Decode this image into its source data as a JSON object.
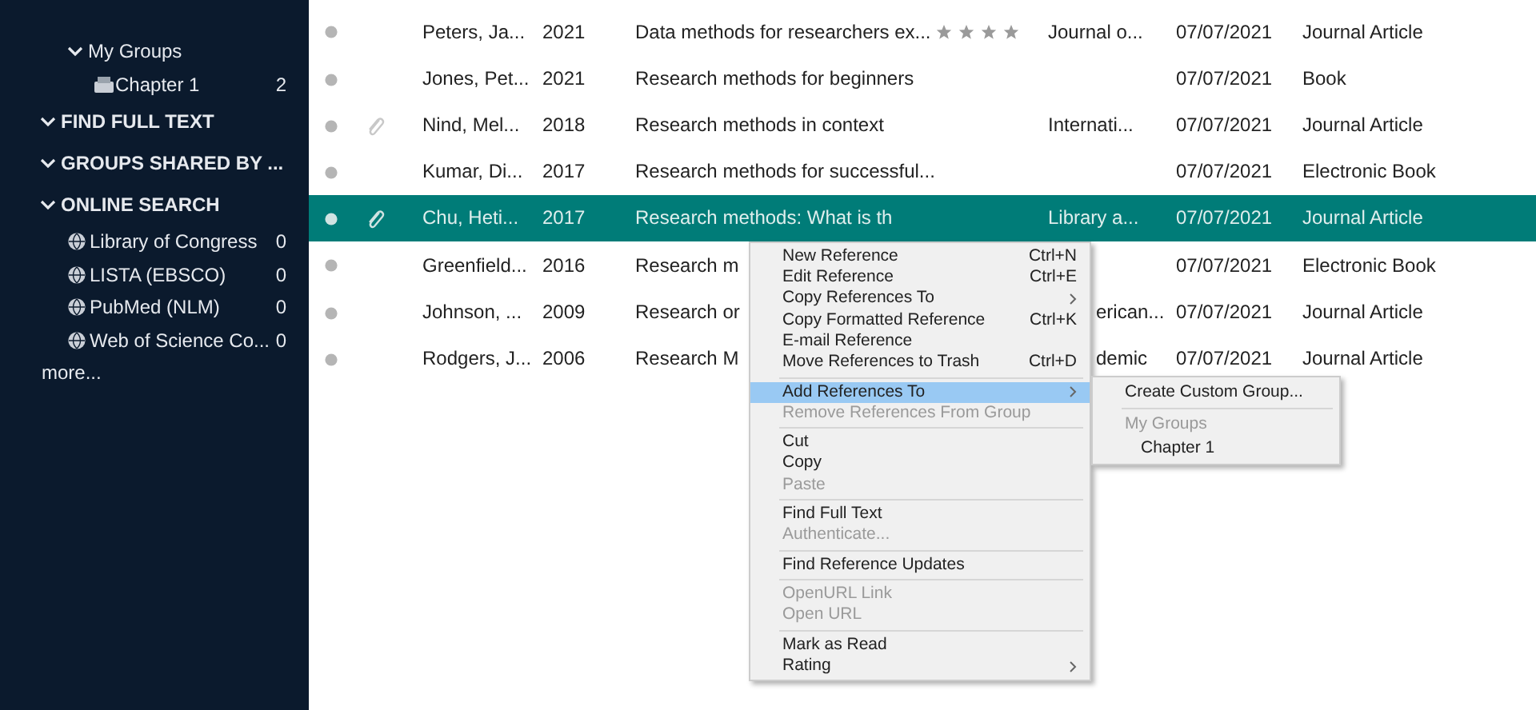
{
  "sidebar": {
    "items": [
      {
        "kind": "group_header",
        "label": "My Groups",
        "expanded": true,
        "children": [
          {
            "kind": "group",
            "label": "Chapter 1",
            "count": "2"
          }
        ]
      },
      {
        "kind": "section",
        "label": "FIND FULL TEXT",
        "expanded": true
      },
      {
        "kind": "section",
        "label": "GROUPS SHARED BY ...",
        "expanded": true
      },
      {
        "kind": "section",
        "label": "ONLINE SEARCH",
        "expanded": true,
        "children": [
          {
            "kind": "source",
            "label": "Library of Congress",
            "count": "0"
          },
          {
            "kind": "source",
            "label": "LISTA (EBSCO)",
            "count": "0"
          },
          {
            "kind": "source",
            "label": "PubMed (NLM)",
            "count": "0"
          },
          {
            "kind": "source",
            "label": "Web of Science Co...",
            "count": "0"
          }
        ]
      },
      {
        "kind": "more",
        "label": "more..."
      }
    ]
  },
  "table": {
    "rows": [
      {
        "attachment": false,
        "author": "Peters, Ja...",
        "year": "2021",
        "title": "Data methods for researchers ex...",
        "stars": 4,
        "journal": "Journal o...",
        "added": "07/07/2021",
        "type": "Journal Article",
        "selected": false
      },
      {
        "attachment": false,
        "author": "Jones, Pet...",
        "year": "2021",
        "title": "Research methods for beginners",
        "added": "07/07/2021",
        "type": "Book",
        "selected": false
      },
      {
        "attachment": true,
        "author": "Nind, Mel...",
        "year": "2018",
        "title": "Research methods in context",
        "journal": "Internati...",
        "added": "07/07/2021",
        "type": "Journal Article",
        "selected": false
      },
      {
        "attachment": false,
        "author": "Kumar, Di...",
        "year": "2017",
        "title": "Research methods for successful...",
        "added": "07/07/2021",
        "type": "Electronic Book",
        "selected": false
      },
      {
        "attachment": true,
        "author": "Chu, Heti...",
        "year": "2017",
        "title": "Research methods: What is th",
        "journal": "Library a...",
        "added": "07/07/2021",
        "type": "Journal Article",
        "selected": true
      },
      {
        "attachment": false,
        "author": "Greenfield...",
        "year": "2016",
        "title": "Research m",
        "added": "07/07/2021",
        "type": "Electronic Book",
        "selected": false
      },
      {
        "attachment": false,
        "author": "Johnson, ...",
        "year": "2009",
        "title": "Research or",
        "journal": "erican...",
        "added": "07/07/2021",
        "type": "Journal Article",
        "selected": false
      },
      {
        "attachment": false,
        "author": "Rodgers, J...",
        "year": "2006",
        "title": "Research M",
        "journal": "demic",
        "added": "07/07/2021",
        "type": "Journal Article",
        "selected": false
      }
    ]
  },
  "context_menu": {
    "items": [
      {
        "kind": "item",
        "label": "New Reference",
        "shortcut": "Ctrl+N",
        "disabled": false,
        "submenu": false,
        "selected": false
      },
      {
        "kind": "item",
        "label": "Edit Reference",
        "shortcut": "Ctrl+E",
        "disabled": false,
        "submenu": false,
        "selected": false
      },
      {
        "kind": "item",
        "label": "Copy References To",
        "disabled": false,
        "submenu": true,
        "selected": false
      },
      {
        "kind": "item",
        "label": "Copy Formatted Reference",
        "shortcut": "Ctrl+K",
        "disabled": false,
        "submenu": false,
        "selected": false
      },
      {
        "kind": "item",
        "label": "E-mail Reference",
        "disabled": false,
        "submenu": false,
        "selected": false
      },
      {
        "kind": "item",
        "label": "Move References to Trash",
        "shortcut": "Ctrl+D",
        "disabled": false,
        "submenu": false,
        "selected": false
      },
      {
        "kind": "separator"
      },
      {
        "kind": "item",
        "label": "Add References To",
        "disabled": false,
        "submenu": true,
        "selected": true
      },
      {
        "kind": "item",
        "label": "Remove References From Group",
        "disabled": true,
        "submenu": false,
        "selected": false
      },
      {
        "kind": "separator"
      },
      {
        "kind": "item",
        "label": "Cut",
        "disabled": false,
        "submenu": false,
        "selected": false
      },
      {
        "kind": "item",
        "label": "Copy",
        "disabled": false,
        "submenu": false,
        "selected": false
      },
      {
        "kind": "item",
        "label": "Paste",
        "disabled": true,
        "submenu": false,
        "selected": false
      },
      {
        "kind": "separator"
      },
      {
        "kind": "item",
        "label": "Find Full Text",
        "disabled": false,
        "submenu": false,
        "selected": false
      },
      {
        "kind": "item",
        "label": "Authenticate...",
        "disabled": true,
        "submenu": false,
        "selected": false
      },
      {
        "kind": "separator"
      },
      {
        "kind": "item",
        "label": "Find Reference Updates",
        "disabled": false,
        "submenu": false,
        "selected": false
      },
      {
        "kind": "separator"
      },
      {
        "kind": "item",
        "label": "OpenURL Link",
        "disabled": true,
        "submenu": false,
        "selected": false
      },
      {
        "kind": "item",
        "label": "Open URL",
        "disabled": true,
        "submenu": false,
        "selected": false
      },
      {
        "kind": "separator"
      },
      {
        "kind": "item",
        "label": "Mark as Read",
        "disabled": false,
        "submenu": false,
        "selected": false
      },
      {
        "kind": "item",
        "label": "Rating",
        "disabled": false,
        "submenu": true,
        "selected": false
      }
    ],
    "submenu": {
      "items": [
        {
          "kind": "item",
          "label": "Create Custom Group..."
        },
        {
          "kind": "separator"
        },
        {
          "kind": "heading",
          "label": "My Groups"
        },
        {
          "kind": "subitem",
          "label": "Chapter 1"
        }
      ]
    }
  }
}
